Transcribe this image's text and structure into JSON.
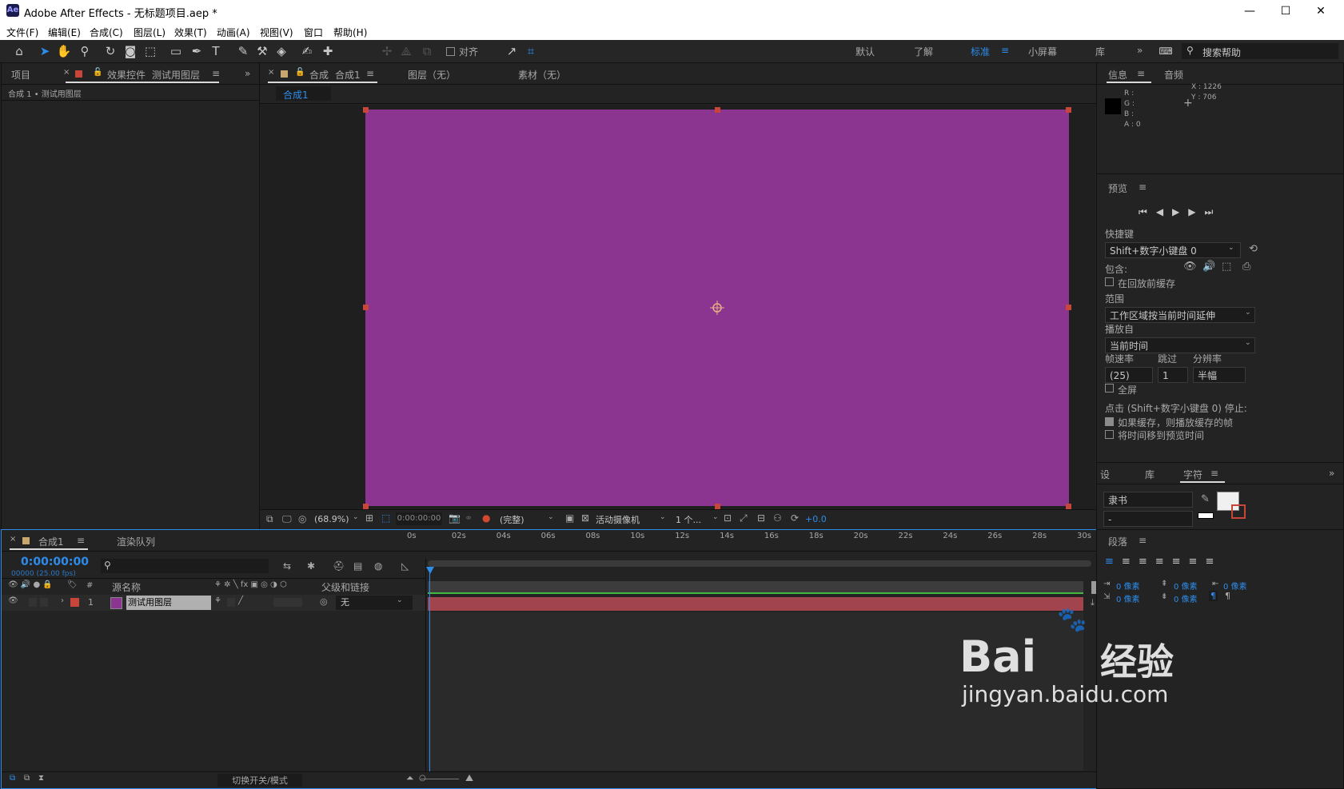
{
  "window": {
    "title": "Adobe After Effects - 无标题项目.aep *",
    "logo": "Ae",
    "min": "—",
    "max": "☐",
    "close": "✕"
  },
  "menu": [
    "文件(F)",
    "编辑(E)",
    "合成(C)",
    "图层(L)",
    "效果(T)",
    "动画(A)",
    "视图(V)",
    "窗口",
    "帮助(H)"
  ],
  "toolbar": {
    "snap_label": "对齐",
    "workspaces": [
      "默认",
      "了解",
      "标准",
      "小屏幕",
      "库"
    ],
    "active_workspace": "标准",
    "search_placeholder": "搜索帮助"
  },
  "project_panel": {
    "tab_project": "项目",
    "tab_effects_prefix": "效果控件",
    "tab_effects_layer": "测试用图层",
    "breadcrumb": "合成 1 • 测试用图层"
  },
  "comp_panel": {
    "tab_prefix": "合成",
    "tab_name": "合成1",
    "tab_layer": "图层（无）",
    "tab_footage": "素材（无）",
    "subtab": "合成1"
  },
  "comp_footer": {
    "zoom": "(68.9%)",
    "time": "0:00:00:00",
    "resolution": "(完整)",
    "camera": "活动摄像机",
    "views": "1 个...",
    "exposure": "+0.0"
  },
  "colors": {
    "canvas": "#8b3591",
    "accent": "#2d8ceb",
    "layer_bar": "#a2444e",
    "label_red": "#c8453a"
  },
  "info_panel": {
    "tab_info": "信息",
    "tab_audio": "音频",
    "r": "R :",
    "g": "G :",
    "b": "B :",
    "a": "A : 0",
    "x": "X : 1226",
    "y": "Y : 706"
  },
  "preview_panel": {
    "title": "预览",
    "shortcut_label": "快捷键",
    "shortcut_value": "Shift+数字小键盘 0",
    "include_label": "包含:",
    "cache_before": "在回放前缓存",
    "range_label": "范围",
    "range_value": "工作区域按当前时间延伸",
    "play_from_label": "播放自",
    "play_from_value": "当前时间",
    "fps_label": "帧速率",
    "skip_label": "跳过",
    "res_label": "分辨率",
    "fps_value": "(25)",
    "skip_value": "1",
    "res_value": "半幅",
    "fullscreen": "全屏",
    "stop_label": "点击 (Shift+数字小键盘 0) 停止:",
    "if_cached": "如果缓存，则播放缓存的帧",
    "move_time": "将时间移到预览时间"
  },
  "char_panel": {
    "tab_settings": "设",
    "tab_library": "库",
    "tab_char": "字符",
    "font": "隶书",
    "style": "-"
  },
  "para_panel": {
    "title": "段落",
    "px1": "0 像素",
    "px2": "0 像素",
    "px3": "0 像素",
    "px4": "0 像素",
    "px5": "0 像素"
  },
  "timeline": {
    "tab_comp": "合成1",
    "tab_render": "渲染队列",
    "timecode": "0:00:00:00",
    "frames": "00000 (25.00 fps)",
    "col_source": "源名称",
    "col_parent": "父级和链接",
    "layer_num": "1",
    "layer_name": "测试用图层",
    "layer_parent": "无",
    "toggle_modes": "切换开关/模式",
    "ruler": [
      "0s",
      "02s",
      "04s",
      "06s",
      "08s",
      "10s",
      "12s",
      "14s",
      "16s",
      "18s",
      "20s",
      "22s",
      "24s",
      "26s",
      "28s",
      "30s"
    ]
  },
  "watermark": {
    "brand": "Bai",
    "brand2": "经验",
    "url": "jingyan.baidu.com"
  }
}
